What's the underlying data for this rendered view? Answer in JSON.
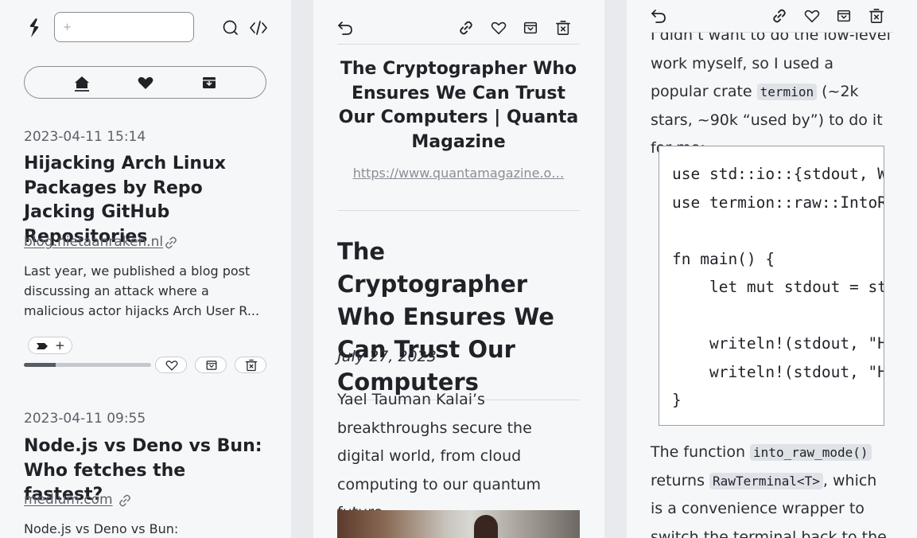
{
  "list": {
    "search": {
      "placeholder": "+"
    },
    "nav": {
      "icons": [
        "home-icon",
        "heart-icon",
        "archive-icon"
      ]
    },
    "articles": [
      {
        "date": "2023-04-11 15:14",
        "title": "Hijacking Arch Linux Packages by Repo Jacking GitHub Repositories",
        "domain": "blog.nietaanraken.nl",
        "description": "Last year, we published a blog post discussing an attack where a malicious actor hijacks Arch User R...",
        "tag_add": "+",
        "progress": 0.25
      },
      {
        "date": "2023-04-11 09:55",
        "title": "Node.js vs Deno vs Bun: Who fetches the fastest?",
        "domain": "medium.com",
        "description": "Node.js vs Deno vs Bun:"
      }
    ]
  },
  "reader": {
    "card_title": "The Cryptographer Who Ensures We Can Trust Our Computers | Quanta Magazine",
    "url": "https://www.quantamagazine.o…",
    "headline": "The Cryptographer Who Ensures We Can Trust Our Computers",
    "date": "July 27, 2023",
    "lede": "Yael Tauman Kalai’s breakthroughs secure the digital world, from cloud computing to our quantum future."
  },
  "reader2": {
    "para1_top": "I didn’t want to do the low-level work myself, so I used a popular crate",
    "crate": "termion",
    "para1_rest": "(~2k stars, ~90k “used by”) to do it for me:",
    "code_lines": [
      "use std::io::{stdout, Write};",
      "use termion::raw::IntoRawMode;",
      "",
      "fn main() {",
      "    let mut stdout = stdout().into_raw_mode().unwrap();",
      "",
      "    writeln!(stdout, \"Hey there.\").unwrap();",
      "    writeln!(stdout, \"Hey there.\").unwrap();",
      "}"
    ],
    "para2_a": "The function",
    "fn1": "into_raw_mode()",
    "para2_b": "returns",
    "fn2": "RawTerminal<T>",
    "para2_c": ", which is a convenience wrapper to switch the terminal back to the"
  }
}
